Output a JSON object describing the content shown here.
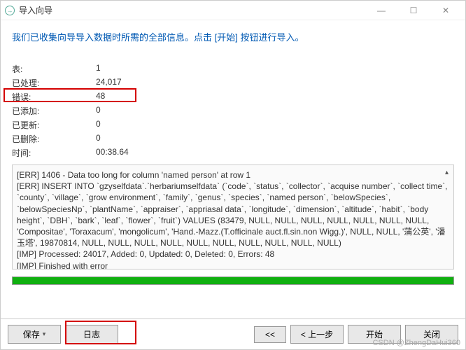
{
  "titlebar": {
    "icon_label": "→",
    "title": "导入向导"
  },
  "instruction": "我们已收集向导导入数据时所需的全部信息。点击 [开始] 按钮进行导入。",
  "stats": {
    "table_label": "表:",
    "table_value": "1",
    "processed_label": "已处理:",
    "processed_value": "24,017",
    "errors_label": "错误:",
    "errors_value": "48",
    "added_label": "已添加:",
    "added_value": "0",
    "updated_label": "已更新:",
    "updated_value": "0",
    "deleted_label": "已删除:",
    "deleted_value": "0",
    "time_label": "时间:",
    "time_value": "00:38.64"
  },
  "log": {
    "line1": "[ERR] 1406 - Data too long for column 'named person' at row 1",
    "line2": "[ERR] INSERT INTO `gzyselfdata`.`herbariumselfdata` (`code`, `status`, `collector`, `acquise number`, `collect time`, `county`, `village`, `grow environment`, `family`, `genus`, `species`, `named person`, `belowSpecies`, `belowSpeciesNp`, `plantName`, `appraiser`, `appriasal data`, `longitude`, `dimension`, `altitude`, `habit`, `body height`, `DBH`, `bark`, `leaf`, `flower`, `fruit`) VALUES (83479, NULL, NULL, NULL, NULL, NULL, NULL, NULL, 'Compositae', 'Toraxacum', 'mongolicum', 'Hand.-Mazz.(T.officinale  auct.fl.sin.non Wigg.)', NULL, NULL, '蒲公英', '潘玉塔', 19870814, NULL, NULL, NULL, NULL, NULL, NULL, NULL, NULL, NULL, NULL)",
    "line3": "[IMP] Processed: 24017, Added: 0, Updated: 0, Deleted: 0, Errors: 48",
    "line4": "[IMP] Finished with error"
  },
  "footer": {
    "save": "保存",
    "log": "日志",
    "first": "<<",
    "prev": "< 上一步",
    "start": "开始",
    "close": "关闭"
  },
  "watermark": "CSDN @ZhengDaHui360"
}
